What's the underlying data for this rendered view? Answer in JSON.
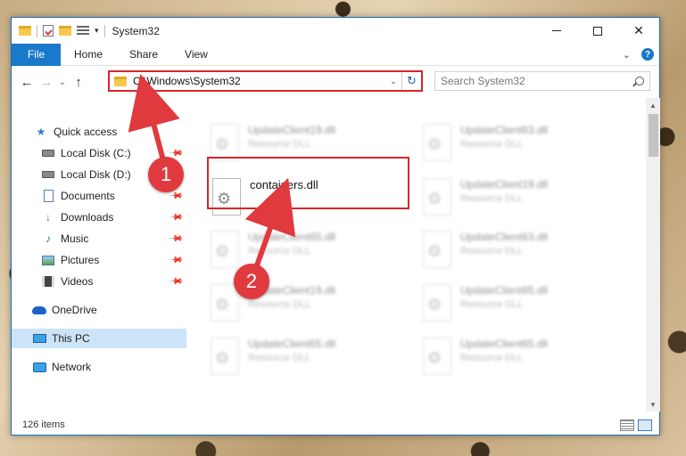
{
  "window": {
    "title": "System32",
    "minimize_glyph": "",
    "close_glyph": "✕"
  },
  "ribbon": {
    "tabs": [
      "File",
      "Home",
      "Share",
      "View"
    ],
    "help_glyph": "?"
  },
  "address": {
    "path": "C:\\Windows\\System32",
    "search_placeholder": "Search System32"
  },
  "nav": {
    "items": [
      {
        "label": "Quick access",
        "icon": "star-icon",
        "pinned": false
      },
      {
        "label": "Local Disk (C:)",
        "icon": "drive-icon",
        "pinned": true
      },
      {
        "label": "Local Disk (D:)",
        "icon": "drive-icon",
        "pinned": false
      },
      {
        "label": "Documents",
        "icon": "documents-icon",
        "pinned": true
      },
      {
        "label": "Downloads",
        "icon": "download-icon",
        "pinned": true
      },
      {
        "label": "Music",
        "icon": "music-icon",
        "pinned": true
      },
      {
        "label": "Pictures",
        "icon": "pictures-icon",
        "pinned": true
      },
      {
        "label": "Videos",
        "icon": "videos-icon",
        "pinned": true
      },
      {
        "label": "OneDrive",
        "icon": "onedrive-icon",
        "pinned": false
      },
      {
        "label": "This PC",
        "icon": "this-pc-icon",
        "pinned": false,
        "selected": true
      },
      {
        "label": "Network",
        "icon": "network-icon",
        "pinned": false
      }
    ]
  },
  "files": [
    {
      "name": "UpdateClient19.dll",
      "type": "Resource DLL",
      "blurred": true
    },
    {
      "name": "UpdateClient63.dll",
      "type": "Resource DLL",
      "blurred": true
    },
    {
      "name": "containers.dll",
      "type": "",
      "blurred": false
    },
    {
      "name": "UpdateClient19.dll",
      "type": "Resource DLL",
      "blurred": true
    },
    {
      "name": "UpdateClient65.dll",
      "type": "Resource DLL",
      "blurred": true
    },
    {
      "name": "UpdateClient63.dll",
      "type": "Resource DLL",
      "blurred": true
    },
    {
      "name": "UpdateClient19.dll",
      "type": "Resource DLL",
      "blurred": true
    },
    {
      "name": "UpdateClient65.dll",
      "type": "Resource DLL",
      "blurred": true
    },
    {
      "name": "UpdateClient65.dll",
      "type": "Resource DLL",
      "blurred": true
    },
    {
      "name": "UpdateClient65.dll",
      "type": "Resource DLL",
      "blurred": true
    }
  ],
  "status": {
    "item_count": "126 items"
  },
  "annotations": {
    "step1": "1",
    "step2": "2",
    "color": "#e03a3e"
  }
}
